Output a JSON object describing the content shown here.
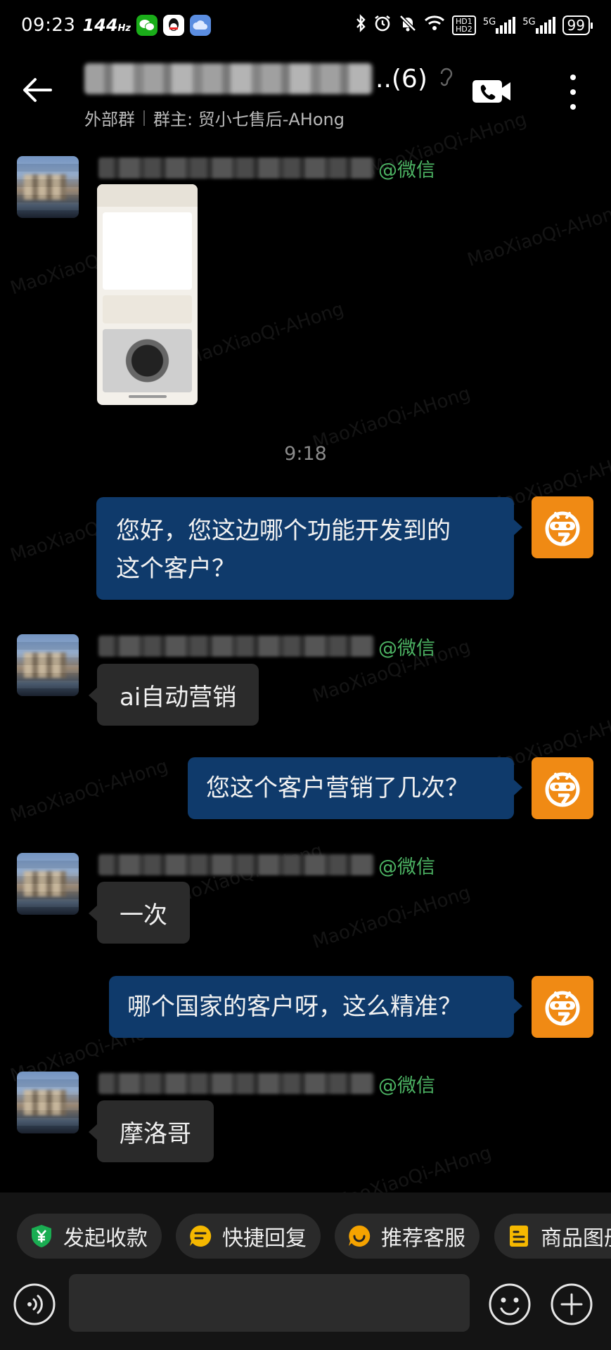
{
  "status_bar": {
    "time": "09:23",
    "refresh_rate": "144",
    "refresh_unit": "Hz",
    "hd_label": "HD1 HD2",
    "network_1": "5G",
    "network_2": "5G",
    "battery": "99"
  },
  "header": {
    "title_count": "..(6)",
    "group_type": "外部群",
    "owner_label": "群主: 贸小七售后-AHong"
  },
  "watermark_text": "MaoXiaoQi-AHong",
  "messages": [
    {
      "type": "incoming_image",
      "sender_tag": "@微信"
    },
    {
      "type": "timestamp",
      "text": "9:18"
    },
    {
      "type": "outgoing",
      "text_line1": "您好，您这边哪个功能开发到的",
      "text_line2": "这个客户？"
    },
    {
      "type": "incoming",
      "sender_tag": "@微信",
      "text": "ai自动营销"
    },
    {
      "type": "outgoing",
      "text": "您这个客户营销了几次？"
    },
    {
      "type": "incoming",
      "sender_tag": "@微信",
      "text": "一次"
    },
    {
      "type": "outgoing",
      "text": "哪个国家的客户呀，这么精准？"
    },
    {
      "type": "incoming",
      "sender_tag": "@微信",
      "text": "摩洛哥"
    }
  ],
  "quick_actions": [
    {
      "label": "发起收款",
      "icon": "payment-shield-icon",
      "color": "#1aad52"
    },
    {
      "label": "快捷回复",
      "icon": "quick-reply-icon",
      "color": "#f5b800"
    },
    {
      "label": "推荐客服",
      "icon": "recommend-agent-icon",
      "color": "#f5a300"
    },
    {
      "label": "商品图册",
      "icon": "product-album-icon",
      "color": "#f5b800"
    }
  ],
  "input": {
    "placeholder": ""
  },
  "colors": {
    "background": "#000000",
    "outgoing_bubble": "#0f3a6b",
    "incoming_bubble": "#2b2b2b",
    "wechat_tag": "#4cb363",
    "bot_avatar": "#f08a14"
  }
}
